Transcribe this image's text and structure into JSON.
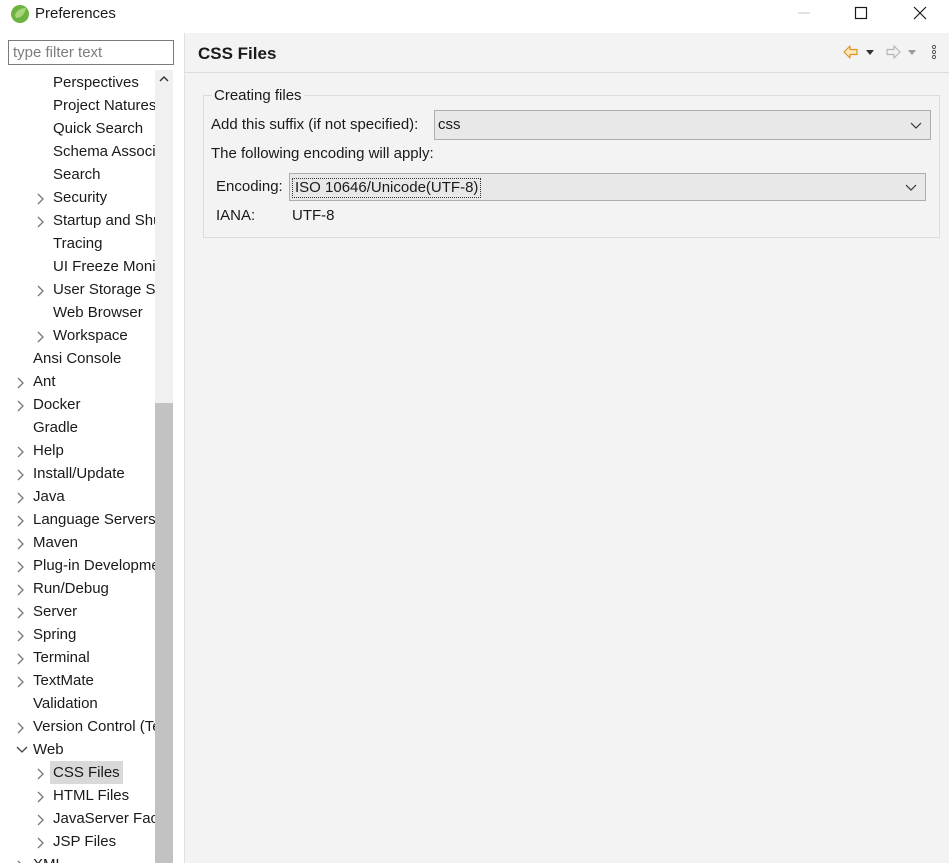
{
  "window": {
    "title": "Preferences"
  },
  "sidebar": {
    "filter_placeholder": "type filter text",
    "items": [
      {
        "label": "Perspectives",
        "indent": 1,
        "expandable": false
      },
      {
        "label": "Project Natures",
        "indent": 1,
        "expandable": false
      },
      {
        "label": "Quick Search",
        "indent": 1,
        "expandable": false
      },
      {
        "label": "Schema Associations",
        "indent": 1,
        "expandable": false
      },
      {
        "label": "Search",
        "indent": 1,
        "expandable": false
      },
      {
        "label": "Security",
        "indent": 1,
        "expandable": true
      },
      {
        "label": "Startup and Shutdown",
        "indent": 1,
        "expandable": true
      },
      {
        "label": "Tracing",
        "indent": 1,
        "expandable": false
      },
      {
        "label": "UI Freeze Monitoring",
        "indent": 1,
        "expandable": false
      },
      {
        "label": "User Storage Service",
        "indent": 1,
        "expandable": true
      },
      {
        "label": "Web Browser",
        "indent": 1,
        "expandable": false
      },
      {
        "label": "Workspace",
        "indent": 1,
        "expandable": true
      },
      {
        "label": "Ansi Console",
        "indent": 0,
        "expandable": false
      },
      {
        "label": "Ant",
        "indent": 0,
        "expandable": true
      },
      {
        "label": "Docker",
        "indent": 0,
        "expandable": true
      },
      {
        "label": "Gradle",
        "indent": 0,
        "expandable": false
      },
      {
        "label": "Help",
        "indent": 0,
        "expandable": true
      },
      {
        "label": "Install/Update",
        "indent": 0,
        "expandable": true
      },
      {
        "label": "Java",
        "indent": 0,
        "expandable": true
      },
      {
        "label": "Language Servers",
        "indent": 0,
        "expandable": true
      },
      {
        "label": "Maven",
        "indent": 0,
        "expandable": true
      },
      {
        "label": "Plug-in Development",
        "indent": 0,
        "expandable": true
      },
      {
        "label": "Run/Debug",
        "indent": 0,
        "expandable": true
      },
      {
        "label": "Server",
        "indent": 0,
        "expandable": true
      },
      {
        "label": "Spring",
        "indent": 0,
        "expandable": true
      },
      {
        "label": "Terminal",
        "indent": 0,
        "expandable": true
      },
      {
        "label": "TextMate",
        "indent": 0,
        "expandable": true
      },
      {
        "label": "Validation",
        "indent": 0,
        "expandable": false
      },
      {
        "label": "Version Control (Team)",
        "indent": 0,
        "expandable": true
      },
      {
        "label": "Web",
        "indent": 0,
        "expandable": true,
        "expanded": true
      },
      {
        "label": "CSS Files",
        "indent": 1,
        "expandable": true,
        "selected": true
      },
      {
        "label": "HTML Files",
        "indent": 1,
        "expandable": true
      },
      {
        "label": "JavaServer Faces Tools",
        "indent": 1,
        "expandable": true
      },
      {
        "label": "JSP Files",
        "indent": 1,
        "expandable": true
      },
      {
        "label": "XML",
        "indent": 0,
        "expandable": true
      }
    ]
  },
  "page": {
    "title": "CSS Files",
    "group_title": "Creating files",
    "suffix_label": "Add this suffix (if not specified):",
    "suffix_value": "css",
    "encoding_intro": "The following encoding will apply:",
    "encoding_label": "Encoding:",
    "encoding_value": "ISO 10646/Unicode(UTF-8)",
    "iana_label": "IANA:",
    "iana_value": "UTF-8"
  },
  "colors": {
    "nav_back_arrow": "#e8a531",
    "nav_disabled": "#b5b5b5",
    "selected_bg": "#d9d9d9"
  }
}
